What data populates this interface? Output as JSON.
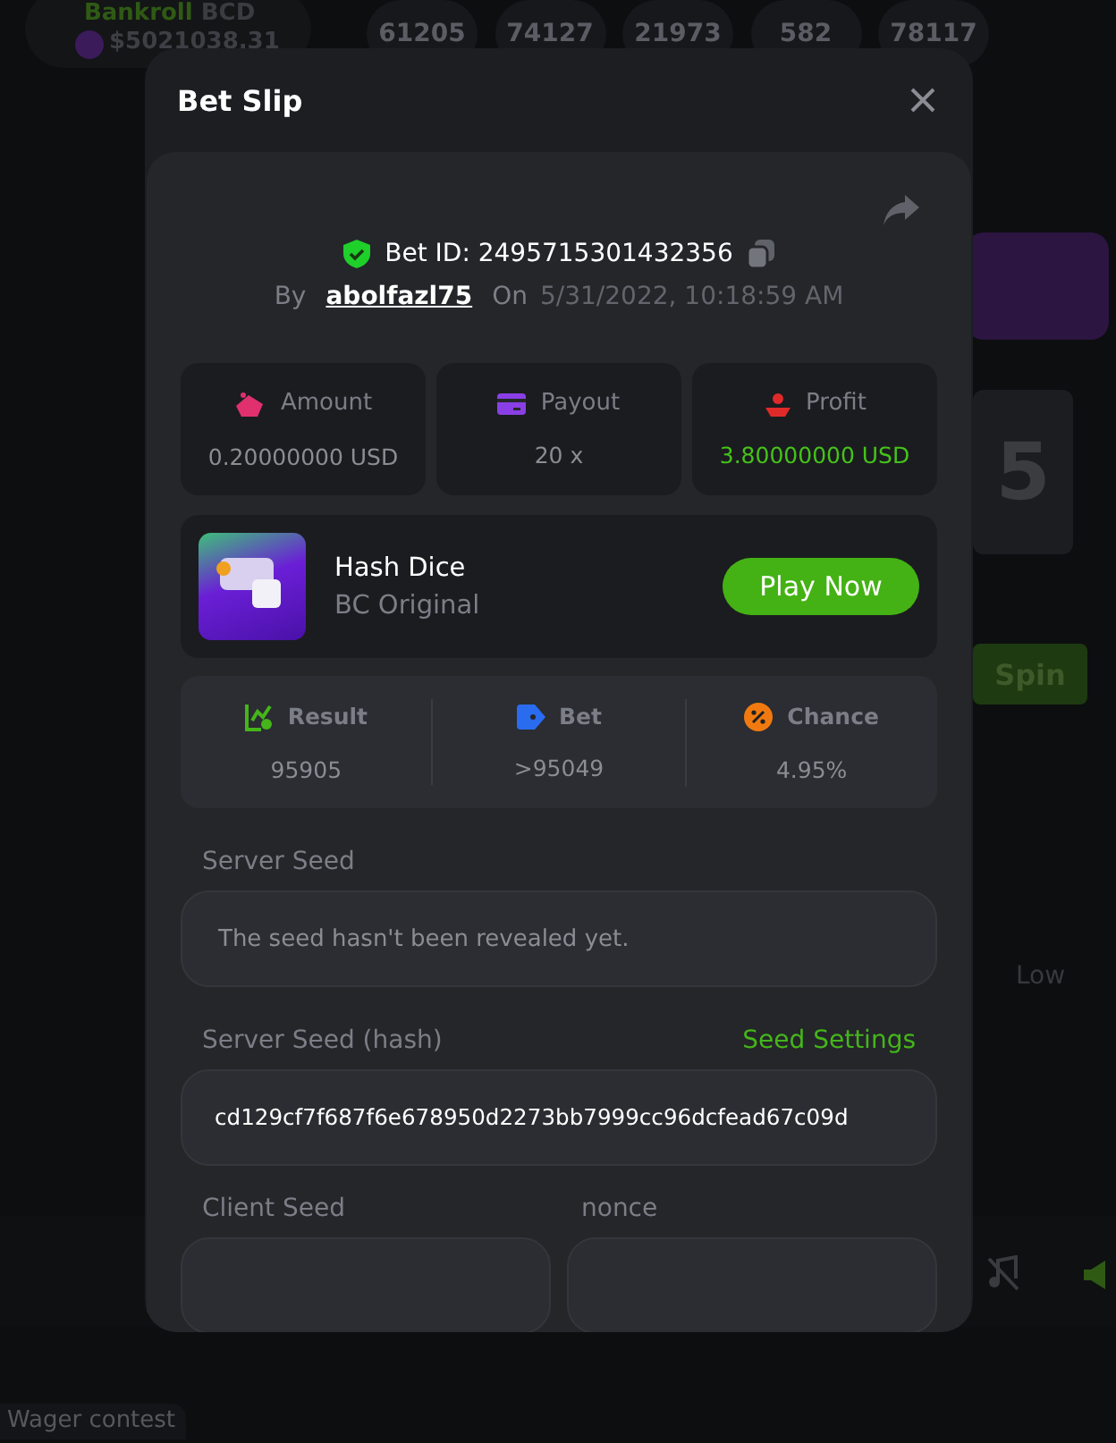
{
  "background": {
    "bankroll_label": "Bankroll",
    "bankroll_currency": "BCD",
    "bankroll_value": "$5021038.31",
    "recent_results": [
      "61205",
      "74127",
      "21973",
      "582",
      "78117"
    ],
    "reel_digit": "5",
    "spin_button": "Spin",
    "low_label": "Low",
    "wager_contest": "Wager contest"
  },
  "modal": {
    "title": "Bet Slip",
    "bet_id": "Bet ID: 2495715301432356",
    "by_label": "By",
    "username": "abolfazl75",
    "on_label": "On",
    "timestamp": "5/31/2022, 10:18:59 AM",
    "summary": [
      {
        "kind": "amount",
        "label": "Amount",
        "value": "0.20000000 USD",
        "positive": false
      },
      {
        "kind": "payout",
        "label": "Payout",
        "value": "20 x",
        "positive": false
      },
      {
        "kind": "profit",
        "label": "Profit",
        "value": "3.80000000 USD",
        "positive": true
      }
    ],
    "game": {
      "name": "Hash Dice",
      "provider": "BC Original",
      "button": "Play Now"
    },
    "details": [
      {
        "kind": "result",
        "label": "Result",
        "value": "95905"
      },
      {
        "kind": "bet",
        "label": "Bet",
        "value": ">95049"
      },
      {
        "kind": "chance",
        "label": "Chance",
        "value": "4.95%"
      }
    ],
    "server_seed": {
      "label": "Server Seed",
      "value": "The seed hasn't been revealed yet."
    },
    "server_seed_hash": {
      "label": "Server Seed (hash)",
      "link": "Seed Settings",
      "value": "cd129cf7f687f6e678950d2273bb7999cc96dcfead67c09d"
    },
    "client_seed": {
      "label": "Client Seed"
    },
    "nonce": {
      "label": "nonce"
    }
  }
}
